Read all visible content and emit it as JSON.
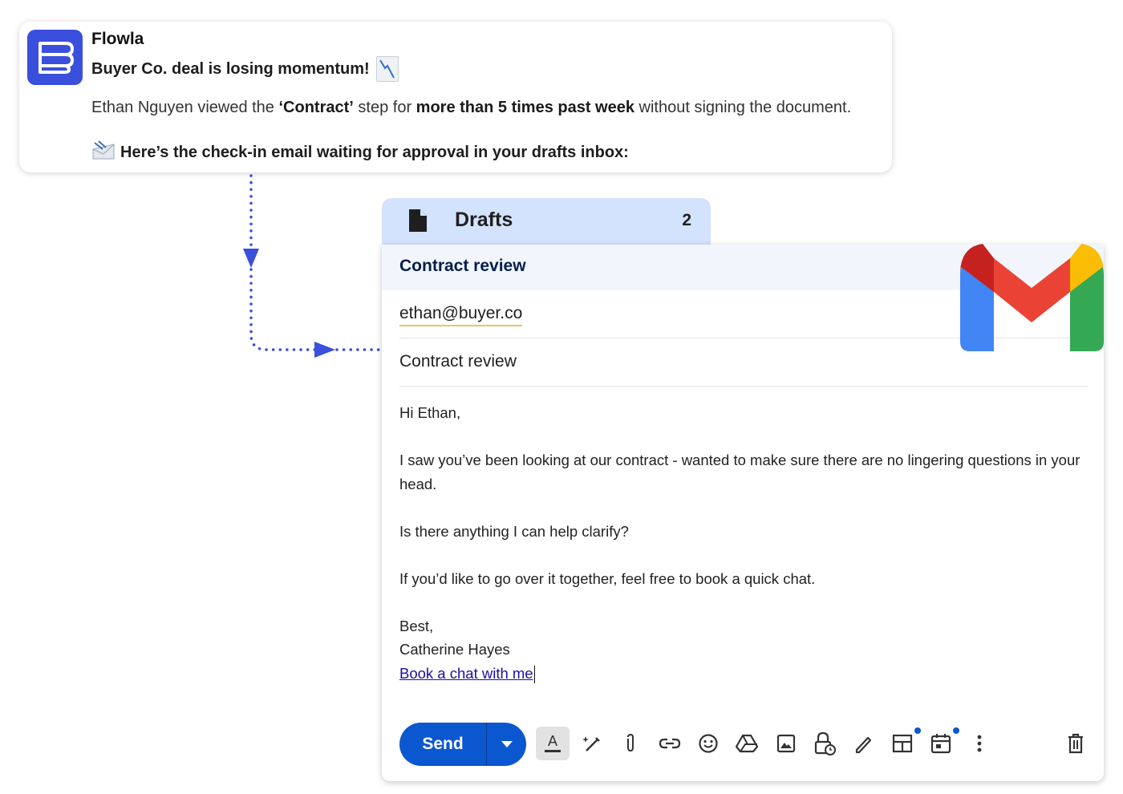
{
  "notification": {
    "app_name": "Flowla",
    "headline": "Buyer Co. deal is losing momentum!",
    "detail": {
      "part1": "Ethan Nguyen viewed the ",
      "bold1": "‘Contract’",
      "part2": " step for ",
      "bold2": "more than 5 times past week",
      "part3": " without signing the document."
    },
    "cta": "Here’s the check-in email waiting for approval in your drafts inbox:"
  },
  "drafts": {
    "label": "Drafts",
    "count": "2"
  },
  "compose": {
    "title": "Contract review",
    "to": "ethan@buyer.co",
    "subject": "Contract review",
    "body": {
      "greeting": "Hi Ethan,",
      "para1": "I saw you’ve been looking at our contract - wanted to make sure there are no lingering questions in your head.",
      "para2": "Is there anything I can help clarify?",
      "para3": "If you’d like to go over it together, feel free to book a quick chat.",
      "signoff": "Best,",
      "signature": "Catherine Hayes",
      "link": "Book a chat with me"
    },
    "toolbar": {
      "send_label": "Send",
      "icons": [
        "format-text-icon",
        "ai-write-icon",
        "attach-icon",
        "link-icon",
        "emoji-icon",
        "drive-icon",
        "image-icon",
        "confidential-icon",
        "signature-icon",
        "layouts-icon",
        "schedule-event-icon",
        "more-options-icon",
        "delete-icon"
      ]
    }
  },
  "colors": {
    "flowla_brand": "#3a4fdc",
    "drafts_tab": "#d3e3fd",
    "send_button": "#0b57d0",
    "connector": "#3a4fdc"
  }
}
